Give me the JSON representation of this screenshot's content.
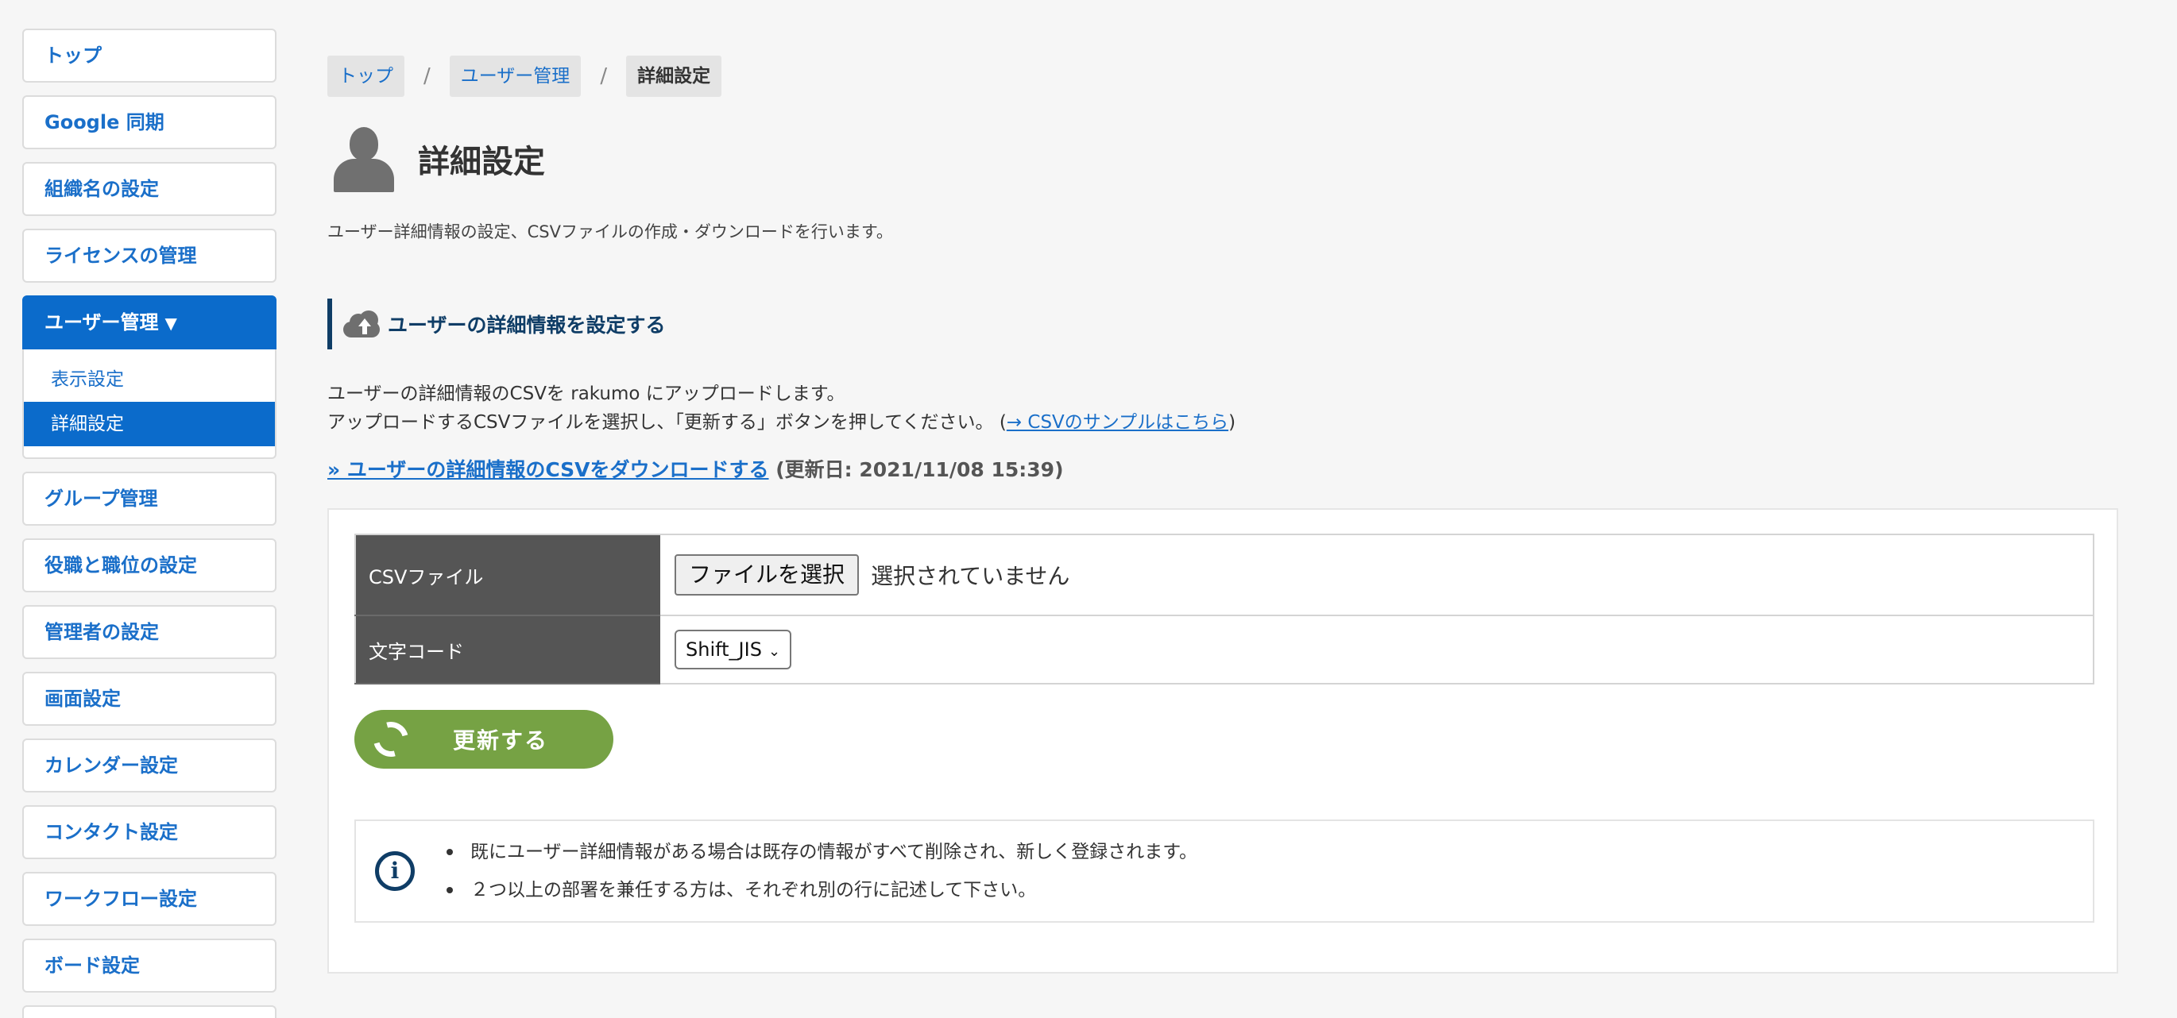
{
  "sidebar": {
    "items": [
      {
        "label": "トップ"
      },
      {
        "label": "Google 同期"
      },
      {
        "label": "組織名の設定"
      },
      {
        "label": "ライセンスの管理"
      },
      {
        "label": "ユーザー管理",
        "caret": "▼"
      },
      {
        "label": "グループ管理"
      },
      {
        "label": "役職と職位の設定"
      },
      {
        "label": "管理者の設定"
      },
      {
        "label": "画面設定"
      },
      {
        "label": "カレンダー設定"
      },
      {
        "label": "コンタクト設定"
      },
      {
        "label": "ワークフロー設定"
      },
      {
        "label": "ボード設定"
      }
    ],
    "submenu": [
      {
        "label": "表示設定"
      },
      {
        "label": "詳細設定"
      }
    ],
    "accent": "#0b6bcb"
  },
  "breadcrumb": {
    "items": [
      "トップ",
      "ユーザー管理",
      "詳細設定"
    ],
    "separator": "/"
  },
  "page": {
    "title": "詳細設定",
    "description": "ユーザー詳細情報の設定、CSVファイルの作成・ダウンロードを行います。",
    "icon": "person-icon"
  },
  "section": {
    "title": "ユーザーの詳細情報を設定する",
    "icon": "cloud-upload-icon",
    "line1": "ユーザーの詳細情報のCSVを rakumo にアップロードします。",
    "line2": "アップロードするCSVファイルを選択し、「更新する」ボタンを押してください。",
    "sample_link_open": " (",
    "sample_link": "→ CSVのサンプルはこちら",
    "sample_link_close": ")",
    "download_link": "» ユーザーの詳細情報のCSVをダウンロードする",
    "updated": "(更新日: 2021/11/08 15:39)"
  },
  "form": {
    "csv_label": "CSVファイル",
    "file_button": "ファイルを選択",
    "file_status": "選択されていません",
    "encoding_label": "文字コード",
    "encoding_value": "Shift_JIS"
  },
  "update_button": {
    "label": "更新する",
    "icon": "sync-icon",
    "color": "#76a244"
  },
  "notice": {
    "icon": "info-icon",
    "items": [
      "既にユーザー詳細情報がある場合は既存の情報がすべて削除され、新しく登録されます。",
      "２つ以上の部署を兼任する方は、それぞれ別の行に記述して下さい。"
    ]
  }
}
